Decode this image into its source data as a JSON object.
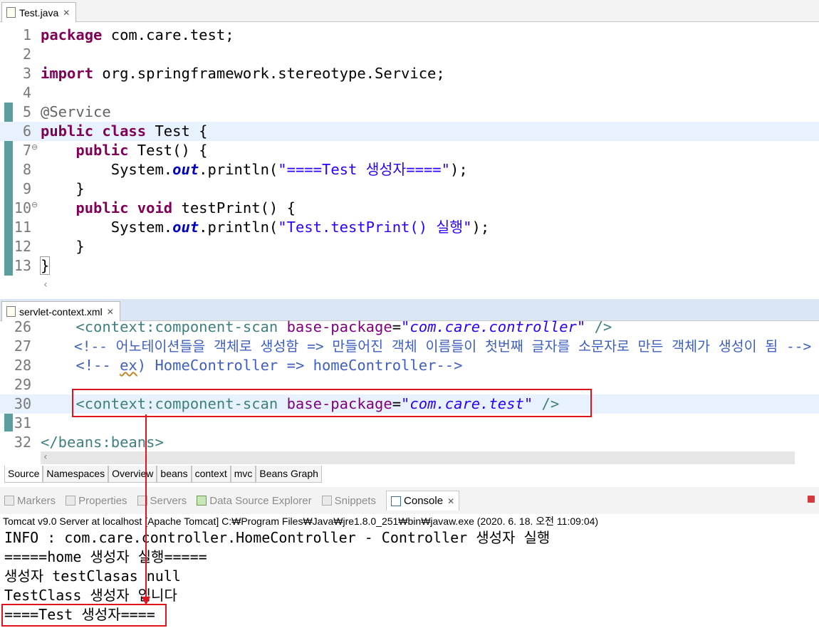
{
  "editor1": {
    "tab": "Test.java",
    "lines": [
      {
        "n": "1",
        "code": "package com.care.test;"
      },
      {
        "n": "2",
        "code": ""
      },
      {
        "n": "3",
        "code": "import org.springframework.stereotype.Service;"
      },
      {
        "n": "4",
        "code": ""
      },
      {
        "n": "5",
        "code": "@Service"
      },
      {
        "n": "6",
        "code": "public class Test {"
      },
      {
        "n": "7",
        "code": "    public Test() {"
      },
      {
        "n": "8",
        "code": "        System.out.println(\"====Test 생성자====\");"
      },
      {
        "n": "9",
        "code": "    }"
      },
      {
        "n": "10",
        "code": "    public void testPrint() {"
      },
      {
        "n": "11",
        "code": "        System.out.println(\"Test.testPrint() 실행\");"
      },
      {
        "n": "12",
        "code": "    }"
      },
      {
        "n": "13",
        "code": "}"
      }
    ]
  },
  "editor2": {
    "tab": "servlet-context.xml",
    "lines": [
      {
        "n": "26",
        "code": "    <context:component-scan base-package=\"com.care.controller\" />"
      },
      {
        "n": "27",
        "code": "    <!-- 어노테이션들을 객체로 생성함 => 만들어진 객체 이름들이 첫번째 글자를 소문자로 만든 객체가 생성이 됨 -->"
      },
      {
        "n": "28",
        "code": "    <!-- ex) HomeController => homeController-->"
      },
      {
        "n": "29",
        "code": ""
      },
      {
        "n": "30",
        "code": "    <context:component-scan base-package=\"com.care.test\" />"
      },
      {
        "n": "31",
        "code": ""
      },
      {
        "n": "32",
        "code": "</beans:beans>"
      }
    ],
    "subtabs": [
      "Source",
      "Namespaces",
      "Overview",
      "beans",
      "context",
      "mvc",
      "Beans Graph"
    ]
  },
  "console": {
    "tabs": [
      "Markers",
      "Properties",
      "Servers",
      "Data Source Explorer",
      "Snippets",
      "Console"
    ],
    "header": "Tomcat v9.0 Server at localhost [Apache Tomcat] C:₩Program Files₩Java₩jre1.8.0_251₩bin₩javaw.exe  (2020. 6. 18. 오전 11:09:04)",
    "lines": [
      "INFO : com.care.controller.HomeController - Controller 생성자 실행",
      "=====home 생성자 실행=====",
      "생성자 testClasas null",
      "TestClass 생성자 입니다",
      "====Test 생성자===="
    ]
  },
  "colors": {
    "highlight": "#e0141d",
    "keyword": "#7f0055",
    "string": "#2a00ff",
    "tag": "#3f7f7f",
    "attribute": "#7f007f",
    "comment": "#3f5fbf"
  }
}
